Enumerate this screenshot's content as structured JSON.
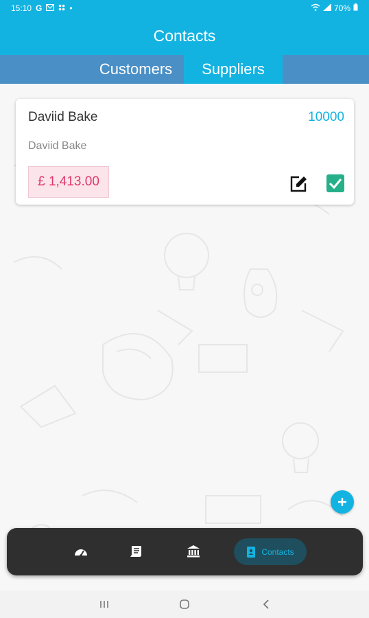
{
  "status_bar": {
    "time": "15:10",
    "notification_icons": [
      "G",
      "mail-icon",
      "grid-icon",
      "•"
    ],
    "battery": "70%"
  },
  "app_bar": {
    "title": "Contacts"
  },
  "tabs": [
    {
      "label": "Customers",
      "selected": false
    },
    {
      "label": "Suppliers",
      "selected": true
    }
  ],
  "contacts": [
    {
      "name": "Daviid Bake",
      "number": "10000",
      "subtitle": "Daviid Bake",
      "balance": "£ 1,413.00"
    }
  ],
  "bottom_nav": {
    "items": [
      {
        "icon": "dashboard-icon"
      },
      {
        "icon": "invoice-icon"
      },
      {
        "icon": "bank-icon"
      },
      {
        "icon": "contacts-icon",
        "label": "Contacts",
        "active": true
      }
    ]
  },
  "colors": {
    "primary": "#13b3e1",
    "tab_bar": "#4a8fc6",
    "balance_text": "#e0386a",
    "balance_bg": "#fbe4ea",
    "check_green": "#26b08a",
    "nav_bg": "#2f2f2f"
  }
}
